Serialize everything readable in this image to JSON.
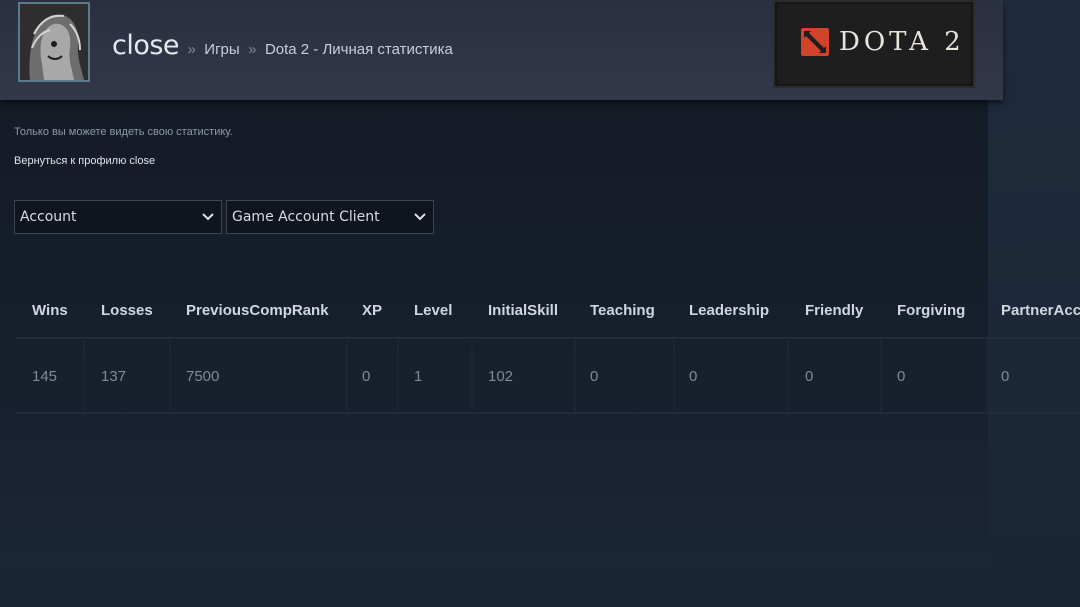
{
  "header": {
    "username": "close",
    "separator": "»",
    "crumb_games": "Игры",
    "crumb_page": "Dota 2 - Личная статистика",
    "logo_text": "DOTA 2",
    "logo_color": "#d2432c"
  },
  "privacy_note": "Только вы можете видеть свою статистику.",
  "back_link": "Вернуться к профилю close",
  "selects": {
    "category": {
      "value": "Account"
    },
    "source": {
      "value": "Game Account Client"
    }
  },
  "table": {
    "columns": [
      "Wins",
      "Losses",
      "PreviousCompRank",
      "XP",
      "Level",
      "InitialSkill",
      "Teaching",
      "Leadership",
      "Friendly",
      "Forgiving",
      "PartnerAcc"
    ],
    "row": [
      "145",
      "137",
      "7500",
      "0",
      "1",
      "102",
      "0",
      "0",
      "0",
      "0",
      "0"
    ]
  },
  "colors": {
    "background": "#1b2838",
    "header": "#2f3545",
    "panel": "#151b25",
    "heading_text": "#cfd6de",
    "cell_text": "#7f8b96"
  }
}
